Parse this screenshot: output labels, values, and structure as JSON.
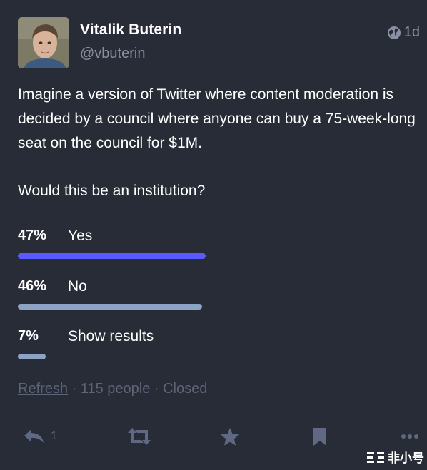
{
  "author": {
    "display_name": "Vitalik Buterin",
    "handle": "@vbuterin"
  },
  "meta": {
    "visibility_icon": "globe-icon",
    "time": "1d"
  },
  "content": {
    "paragraph_1": "Imagine a version of Twitter where content moderation is decided by a council where anyone can buy a 75-week-long seat on the council for $1M.",
    "paragraph_2": "Would this be an institution?"
  },
  "poll": {
    "options": [
      {
        "percent_label": "47%",
        "label": "Yes",
        "share": 0.47,
        "leading": true
      },
      {
        "percent_label": "46%",
        "label": "No",
        "share": 0.46,
        "leading": false
      },
      {
        "percent_label": "7%",
        "label": "Show results",
        "share": 0.07,
        "leading": false
      }
    ],
    "refresh_label": "Refresh",
    "separator": " · ",
    "people": "115 people",
    "status": "Closed"
  },
  "actions": {
    "reply_count": "1"
  },
  "colors": {
    "background": "#282c37",
    "leading_bar": "#595aff",
    "bar": "#8ca3c6",
    "muted": "#606984"
  },
  "watermark": {
    "text": "非小号"
  }
}
